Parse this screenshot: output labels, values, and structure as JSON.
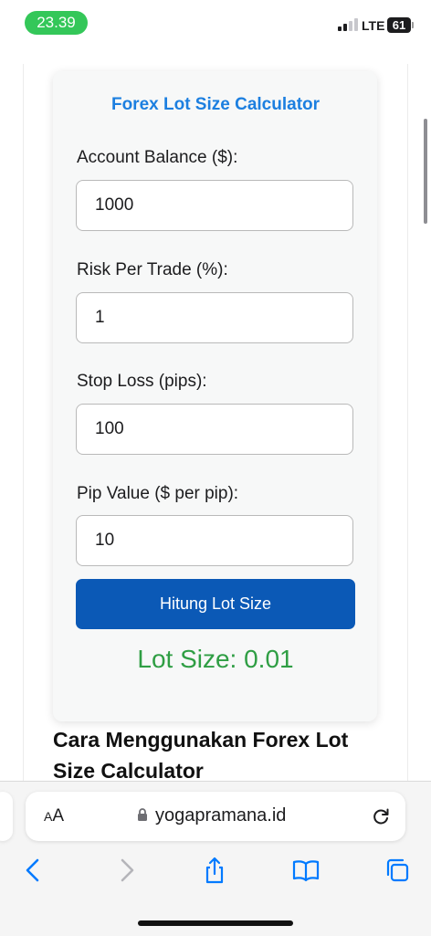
{
  "status_bar": {
    "time": "23.39",
    "network": "LTE",
    "battery": "61"
  },
  "calculator": {
    "title": "Forex Lot Size Calculator",
    "fields": [
      {
        "label": "Account Balance ($):",
        "value": "1000"
      },
      {
        "label": "Risk Per Trade (%):",
        "value": "1"
      },
      {
        "label": "Stop Loss (pips):",
        "value": "100"
      },
      {
        "label": "Pip Value ($ per pip):",
        "value": "10"
      }
    ],
    "button_label": "Hitung Lot Size",
    "result": "Lot Size: 0.01"
  },
  "article": {
    "heading": "Cara Menggunakan Forex Lot Size Calculator"
  },
  "browser": {
    "aa_big": "A",
    "aa_small": "A",
    "url": "yogapramana.id",
    "icons": [
      "back-icon",
      "forward-icon",
      "share-icon",
      "bookmarks-icon",
      "tabs-icon",
      "lock-icon",
      "reload-icon"
    ],
    "accent_color": "#007aff"
  },
  "colors": {
    "title_blue": "#1c7fe0",
    "button_blue": "#0b59b6",
    "result_green": "#2f9e44",
    "status_green": "#34c759"
  }
}
